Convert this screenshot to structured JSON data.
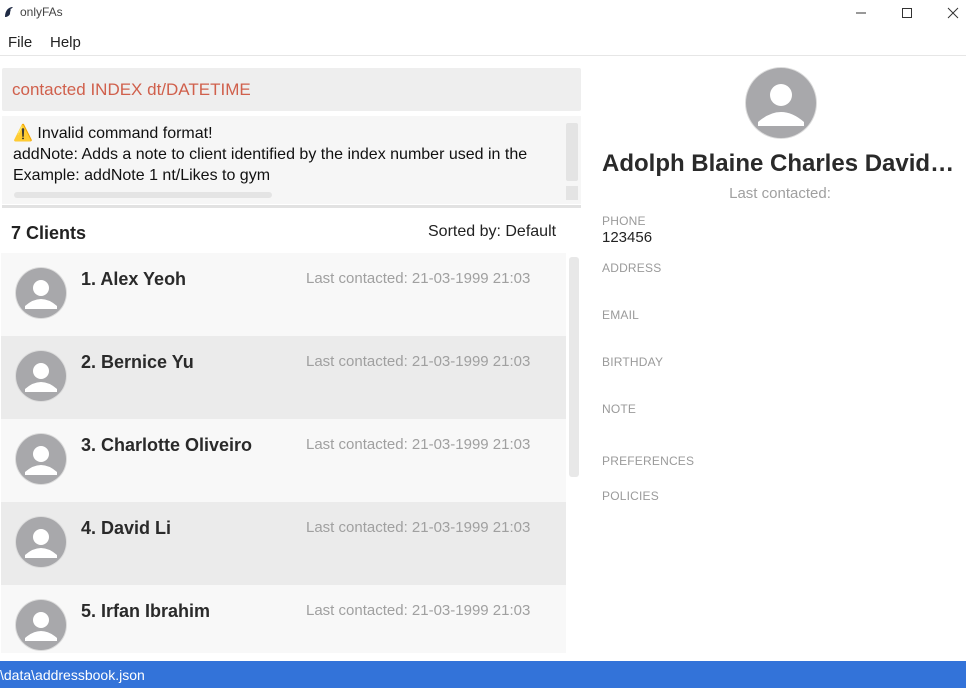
{
  "window": {
    "title": "onlyFAs"
  },
  "menu": {
    "file": "File",
    "help": "Help"
  },
  "command": {
    "text": "contacted INDEX dt/DATETIME"
  },
  "result": {
    "lines": "⚠️ Invalid command format!\naddNote: Adds a note to client identified by the index number used in the\nExample: addNote 1 nt/Likes to gym"
  },
  "list": {
    "count_label": "7 Clients",
    "sorted_label": "Sorted by: Default",
    "clients": [
      {
        "name": "1.  Alex Yeoh",
        "last_contacted": "Last contacted: 21-03-1999 21:03"
      },
      {
        "name": "2.  Bernice Yu",
        "last_contacted": "Last contacted: 21-03-1999 21:03"
      },
      {
        "name": "3.  Charlotte Oliveiro",
        "last_contacted": "Last contacted: 21-03-1999 21:03"
      },
      {
        "name": "4.  David Li",
        "last_contacted": "Last contacted: 21-03-1999 21:03"
      },
      {
        "name": "5.  Irfan Ibrahim",
        "last_contacted": "Last contacted: 21-03-1999 21:03"
      }
    ]
  },
  "detail": {
    "name": "Adolph Blaine Charles David Ea...",
    "last_contacted": "Last contacted:",
    "phone_label": "PHONE",
    "phone_value": "123456",
    "address_label": "ADDRESS",
    "email_label": "EMAIL",
    "birthday_label": "BIRTHDAY",
    "note_label": "NOTE",
    "preferences_label": "PREFERENCES",
    "policies_label": "POLICIES"
  },
  "status": {
    "path": "\\data\\addressbook.json"
  },
  "colors": {
    "command_text": "#d0604c",
    "status_bar": "#3373d9",
    "avatar": "#a8a8ab"
  }
}
